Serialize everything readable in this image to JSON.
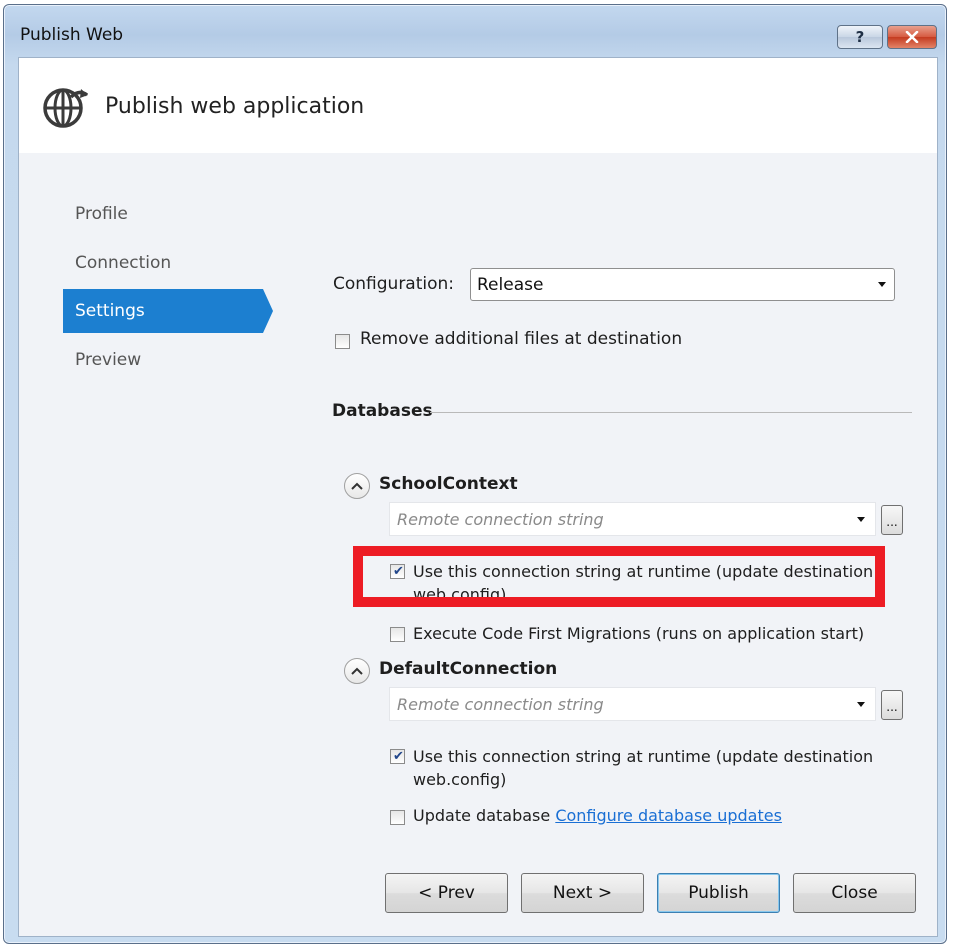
{
  "window": {
    "title": "Publish Web",
    "help_label": "?",
    "close_label": "x"
  },
  "header": {
    "title": "Publish web application",
    "icon": "globe-publish-icon"
  },
  "nav": {
    "items": [
      {
        "label": "Profile",
        "active": false
      },
      {
        "label": "Connection",
        "active": false
      },
      {
        "label": "Settings",
        "active": true
      },
      {
        "label": "Preview",
        "active": false
      }
    ]
  },
  "settings": {
    "configuration_label": "Configuration:",
    "configuration_value": "Release",
    "remove_files_label": "Remove additional files at destination",
    "remove_files_checked": false,
    "databases_heading": "Databases",
    "databases": [
      {
        "name": "SchoolContext",
        "connection_placeholder": "Remote connection string",
        "browse_label": "...",
        "use_runtime_label": "Use this connection string at runtime (update destination",
        "use_runtime_label_line2": "web.config)",
        "use_runtime_checked": true,
        "migrations_label": "Execute Code First Migrations (runs on application start)",
        "migrations_checked": false
      },
      {
        "name": "DefaultConnection",
        "connection_placeholder": "Remote connection string",
        "browse_label": "...",
        "use_runtime_label": "Use this connection string at runtime (update destination",
        "use_runtime_label_line2": "web.config)",
        "use_runtime_checked": true,
        "update_db_label": "Update database",
        "update_db_checked": false,
        "configure_link": "Configure database updates"
      }
    ]
  },
  "buttons": {
    "prev": "< Prev",
    "next": "Next >",
    "publish": "Publish",
    "close": "Close"
  },
  "colors": {
    "accent": "#1c7fd0",
    "highlight": "#ed1c24",
    "link": "#1a6fd4"
  }
}
